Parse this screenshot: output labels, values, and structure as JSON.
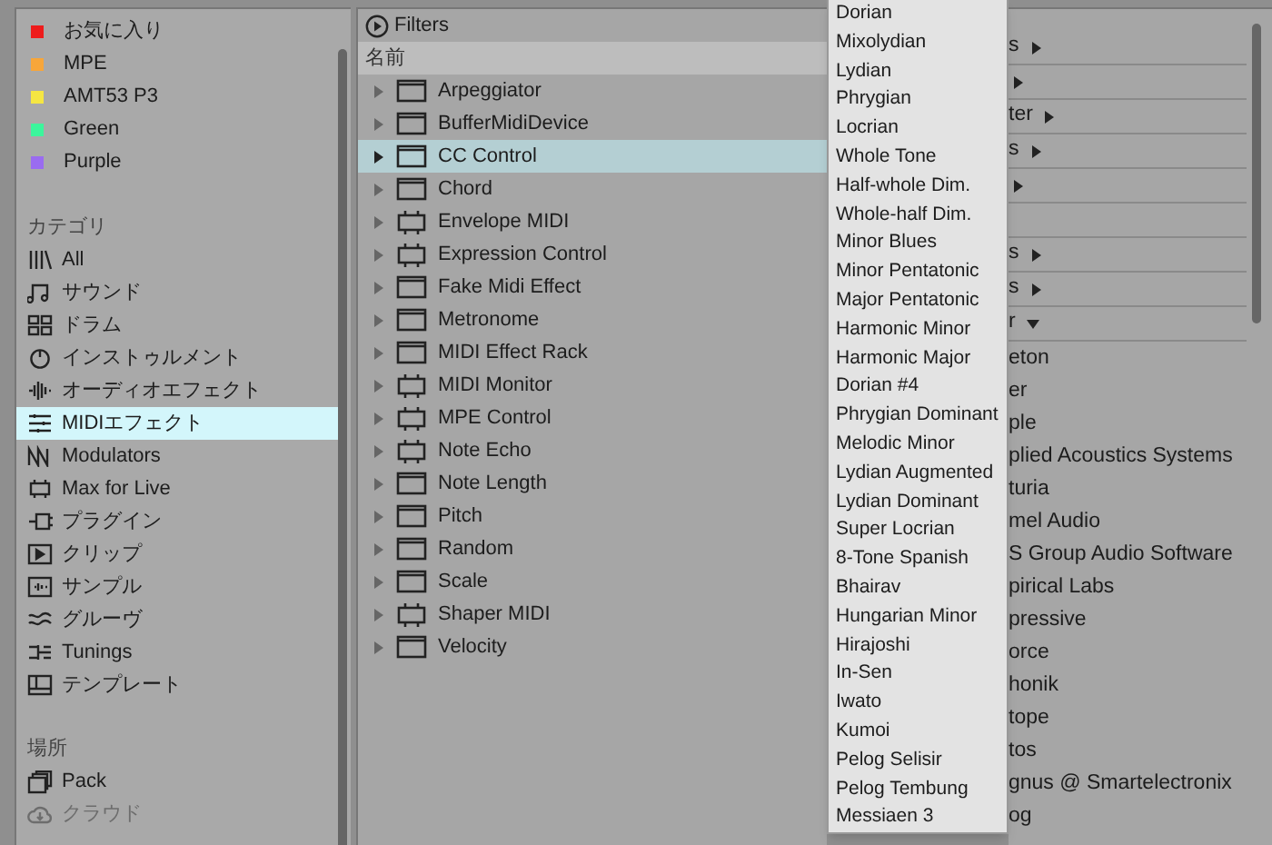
{
  "collections": [
    {
      "label": "お気に入り",
      "color": "#ee1c1c"
    },
    {
      "label": "MPE",
      "color": "#f7a63a"
    },
    {
      "label": "AMT53 P3",
      "color": "#f5e642"
    },
    {
      "label": "Green",
      "color": "#3cf59c"
    },
    {
      "label": "Purple",
      "color": "#9a6cf0"
    }
  ],
  "categories_heading": "カテゴリ",
  "categories": [
    {
      "label": "All",
      "selected": false
    },
    {
      "label": "サウンド",
      "selected": false
    },
    {
      "label": "ドラム",
      "selected": false
    },
    {
      "label": "インストゥルメント",
      "selected": false
    },
    {
      "label": "オーディオエフェクト",
      "selected": false
    },
    {
      "label": "MIDIエフェクト",
      "selected": true
    },
    {
      "label": "Modulators",
      "selected": false
    },
    {
      "label": "Max for Live",
      "selected": false
    },
    {
      "label": "プラグイン",
      "selected": false
    },
    {
      "label": "クリップ",
      "selected": false
    },
    {
      "label": "サンプル",
      "selected": false
    },
    {
      "label": "グルーヴ",
      "selected": false
    },
    {
      "label": "Tunings",
      "selected": false
    },
    {
      "label": "テンプレート",
      "selected": false
    }
  ],
  "places_heading": "場所",
  "places": [
    {
      "label": "Pack",
      "disabled": false
    },
    {
      "label": "クラウド",
      "disabled": true
    }
  ],
  "filters_label": "Filters",
  "name_column": "名前",
  "devices": [
    {
      "label": "Arpeggiator",
      "kind": "device",
      "selected": false
    },
    {
      "label": "BufferMidiDevice",
      "kind": "device",
      "selected": false
    },
    {
      "label": "CC Control",
      "kind": "device",
      "selected": true
    },
    {
      "label": "Chord",
      "kind": "device",
      "selected": false
    },
    {
      "label": "Envelope MIDI",
      "kind": "max",
      "selected": false
    },
    {
      "label": "Expression Control",
      "kind": "max",
      "selected": false
    },
    {
      "label": "Fake Midi Effect",
      "kind": "device",
      "selected": false
    },
    {
      "label": "Metronome",
      "kind": "device",
      "selected": false
    },
    {
      "label": "MIDI Effect Rack",
      "kind": "device",
      "selected": false
    },
    {
      "label": "MIDI Monitor",
      "kind": "max",
      "selected": false
    },
    {
      "label": "MPE Control",
      "kind": "max",
      "selected": false
    },
    {
      "label": "Note Echo",
      "kind": "max",
      "selected": false
    },
    {
      "label": "Note Length",
      "kind": "device",
      "selected": false
    },
    {
      "label": "Pitch",
      "kind": "device",
      "selected": false
    },
    {
      "label": "Random",
      "kind": "device",
      "selected": false
    },
    {
      "label": "Scale",
      "kind": "device",
      "selected": false
    },
    {
      "label": "Shaper MIDI",
      "kind": "max",
      "selected": false
    },
    {
      "label": "Velocity",
      "kind": "device",
      "selected": false
    }
  ],
  "scale_menu": [
    "Dorian",
    "Mixolydian",
    "Lydian",
    "Phrygian",
    "Locrian",
    "Whole Tone",
    "Half-whole Dim.",
    "Whole-half Dim.",
    "Minor Blues",
    "Minor Pentatonic",
    "Major Pentatonic",
    "Harmonic Minor",
    "Harmonic Major",
    "Dorian #4",
    "Phrygian Dominant",
    "Melodic Minor",
    "Lydian Augmented",
    "Lydian Dominant",
    "Super Locrian",
    "8-Tone Spanish",
    "Bhairav",
    "Hungarian Minor",
    "Hirajoshi",
    "In-Sen",
    "Iwato",
    "Kumoi",
    "Pelog Selisir",
    "Pelog Tembung",
    "Messiaen 3"
  ],
  "folders": [
    {
      "kind": "folder",
      "label": "s",
      "expanded": false
    },
    {
      "kind": "folder",
      "expanded": false
    },
    {
      "kind": "folder",
      "label": "ter",
      "expanded": false
    },
    {
      "kind": "folder",
      "label": "s",
      "expanded": false
    },
    {
      "kind": "folder",
      "expanded": false
    },
    {
      "kind": "blank"
    },
    {
      "kind": "folder",
      "label": "s",
      "expanded": false
    },
    {
      "kind": "folder",
      "label": "s",
      "expanded": false
    },
    {
      "kind": "folder",
      "label": "r",
      "expanded": true
    }
  ],
  "vendors": [
    "eton",
    "er",
    "ple",
    "plied Acoustics Systems",
    "turia",
    "mel Audio",
    "S Group Audio Software",
    "pirical Labs",
    "pressive",
    "orce",
    "honik",
    "tope",
    "tos",
    "gnus @ Smartelectronix",
    "og"
  ]
}
